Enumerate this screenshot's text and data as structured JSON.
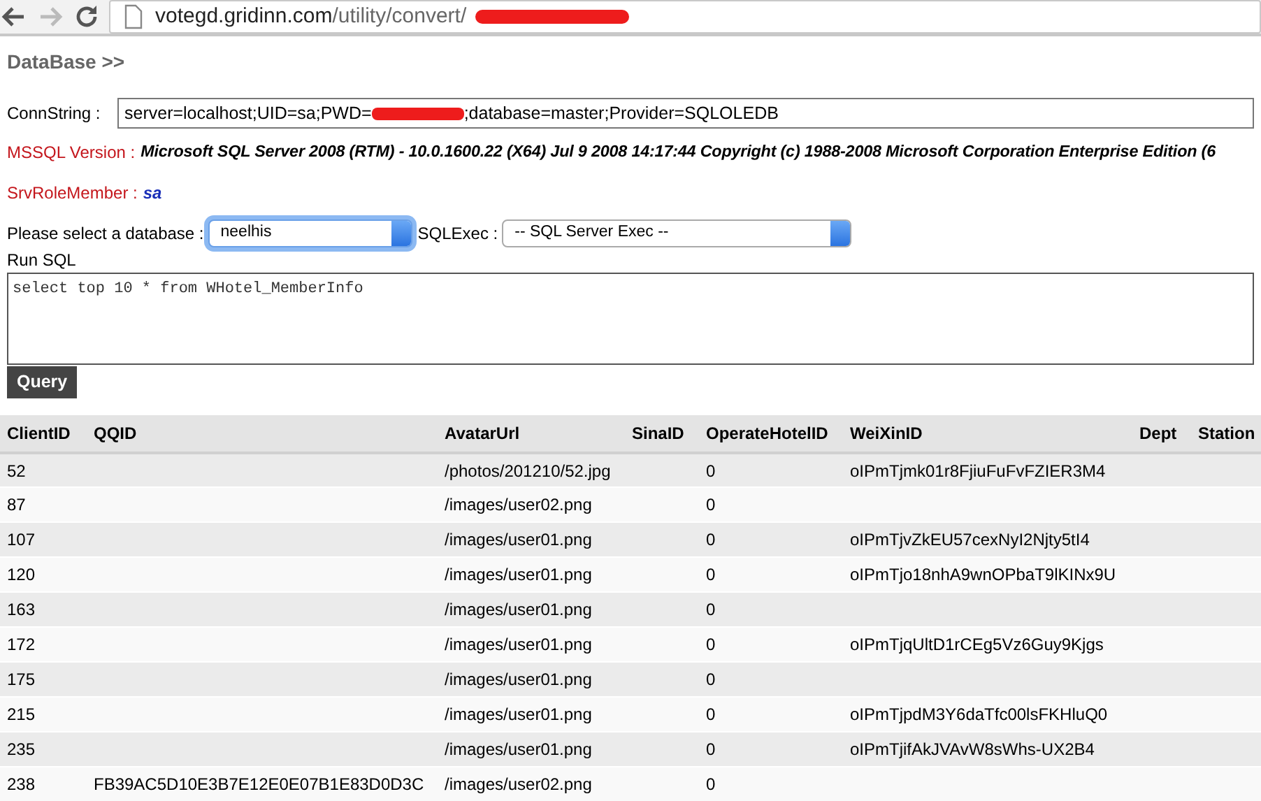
{
  "browser": {
    "back_disabled": false,
    "forward_disabled": true,
    "url_host": "votegd.gridinn.com",
    "url_path": "/utility/convert/"
  },
  "heading": "DataBase >>",
  "conn_string": {
    "label": "ConnString :",
    "value_before_redaction": "server=localhost;UID=sa;PWD=",
    "value_after_redaction": ";database=master;Provider=SQLOLEDB"
  },
  "version": {
    "label": "MSSQL Version :",
    "value": "Microsoft SQL Server 2008 (RTM) - 10.0.1600.22 (X64) Jul 9 2008 14:17:44 Copyright (c) 1988-2008 Microsoft Corporation Enterprise Edition (6"
  },
  "role": {
    "label": "SrvRoleMember :",
    "value": "sa"
  },
  "database_select": {
    "label": "Please select a database :",
    "value": "neelhis",
    "focused": true
  },
  "exec_select": {
    "label": "SQLExec :",
    "value": "-- SQL Server Exec --",
    "focused": false
  },
  "run_sql": {
    "label": "Run SQL",
    "value": "select top 10 * from WHotel_MemberInfo"
  },
  "query_button": "Query",
  "table": {
    "columns": [
      "ClientID",
      "QQID",
      "AvatarUrl",
      "SinaID",
      "OperateHotelID",
      "WeiXinID",
      "Dept",
      "Station"
    ],
    "rows": [
      [
        "52",
        "",
        "/photos/201210/52.jpg",
        "",
        "0",
        "oIPmTjmk01r8FjiuFuFvFZIER3M4",
        "",
        ""
      ],
      [
        "87",
        "",
        "/images/user02.png",
        "",
        "0",
        "",
        "",
        ""
      ],
      [
        "107",
        "",
        "/images/user01.png",
        "",
        "0",
        "oIPmTjvZkEU57cexNyI2Njty5tI4",
        "",
        ""
      ],
      [
        "120",
        "",
        "/images/user01.png",
        "",
        "0",
        "oIPmTjo18nhA9wnOPbaT9lKINx9U",
        "",
        ""
      ],
      [
        "163",
        "",
        "/images/user01.png",
        "",
        "0",
        "",
        "",
        ""
      ],
      [
        "172",
        "",
        "/images/user01.png",
        "",
        "0",
        "oIPmTjqUltD1rCEg5Vz6Guy9Kjgs",
        "",
        ""
      ],
      [
        "175",
        "",
        "/images/user01.png",
        "",
        "0",
        "",
        "",
        ""
      ],
      [
        "215",
        "",
        "/images/user01.png",
        "",
        "0",
        "oIPmTjpdM3Y6daTfc00lsFKHluQ0",
        "",
        ""
      ],
      [
        "235",
        "",
        "/images/user01.png",
        "",
        "0",
        "oIPmTjifAkJVAvW8sWhs-UX2B4",
        "",
        ""
      ],
      [
        "238",
        "FB39AC5D10E3B7E12E0E07B1E83D0D3C",
        "/images/user02.png",
        "",
        "0",
        "",
        "",
        ""
      ]
    ]
  }
}
